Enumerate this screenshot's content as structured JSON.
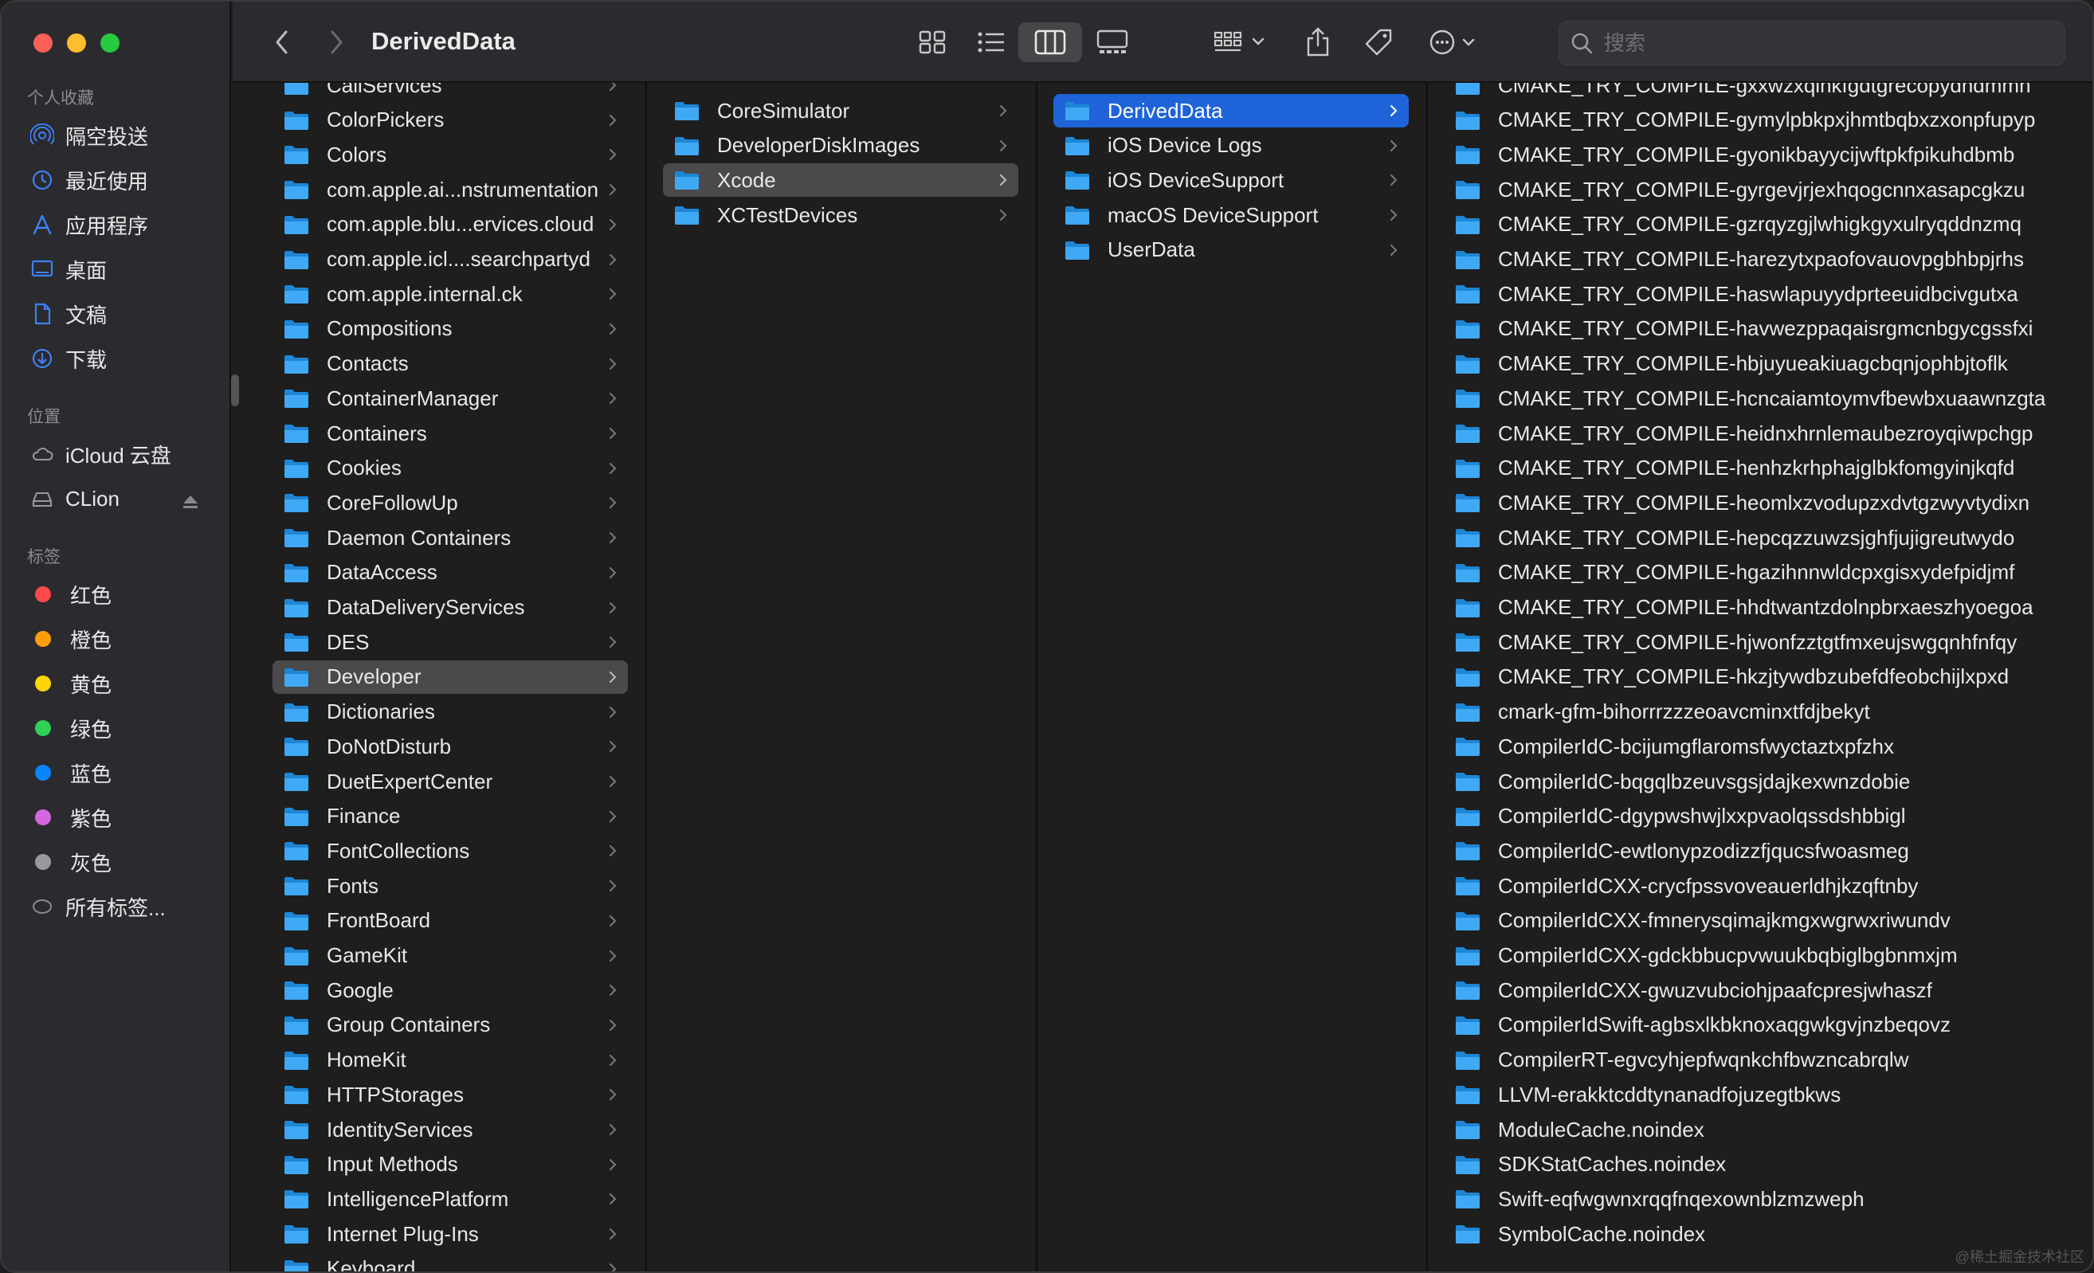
{
  "window": {
    "title": "DerivedData"
  },
  "toolbar": {
    "search_placeholder": "搜索",
    "back": "back",
    "forward": "forward",
    "views": [
      "icon-view",
      "list-view",
      "column-view",
      "gallery-view"
    ],
    "active_view": "column-view"
  },
  "sidebar": {
    "favorites_header": "个人收藏",
    "favorites": [
      {
        "label": "隔空投送",
        "icon": "airdrop-icon"
      },
      {
        "label": "最近使用",
        "icon": "clock-icon"
      },
      {
        "label": "应用程序",
        "icon": "applications-icon"
      },
      {
        "label": "桌面",
        "icon": "desktop-icon"
      },
      {
        "label": "文稿",
        "icon": "document-icon"
      },
      {
        "label": "下载",
        "icon": "download-icon"
      }
    ],
    "locations_header": "位置",
    "locations": [
      {
        "label": "iCloud 云盘",
        "icon": "cloud-icon"
      },
      {
        "label": "CLion",
        "icon": "disk-icon"
      }
    ],
    "tags_header": "标签",
    "tags": [
      {
        "label": "红色",
        "color": "#fe4a4a"
      },
      {
        "label": "橙色",
        "color": "#fe9f0a"
      },
      {
        "label": "黄色",
        "color": "#ffd60a"
      },
      {
        "label": "绿色",
        "color": "#30d158"
      },
      {
        "label": "蓝色",
        "color": "#0a84ff"
      },
      {
        "label": "紫色",
        "color": "#d467e0"
      },
      {
        "label": "灰色",
        "color": "#98989d"
      }
    ],
    "all_tags": "所有标签..."
  },
  "columns": [
    {
      "items": [
        "CallServices",
        "ColorPickers",
        "Colors",
        "com.apple.ai...nstrumentation",
        "com.apple.blu...ervices.cloud",
        "com.apple.icl....searchpartyd",
        "com.apple.internal.ck",
        "Compositions",
        "Contacts",
        "ContainerManager",
        "Containers",
        "Cookies",
        "CoreFollowUp",
        "Daemon Containers",
        "DataAccess",
        "DataDeliveryServices",
        "DES",
        "Developer",
        "Dictionaries",
        "DoNotDisturb",
        "DuetExpertCenter",
        "Finance",
        "FontCollections",
        "Fonts",
        "FrontBoard",
        "GameKit",
        "Google",
        "Group Containers",
        "HomeKit",
        "HTTPStorages",
        "IdentityServices",
        "Input Methods",
        "IntelligencePlatform",
        "Internet Plug-Ins",
        "Keyboard"
      ],
      "selected": "Developer",
      "selected_style": "gray"
    },
    {
      "items": [
        "CoreSimulator",
        "DeveloperDiskImages",
        "Xcode",
        "XCTestDevices"
      ],
      "selected": "Xcode",
      "selected_style": "gray"
    },
    {
      "items": [
        "DerivedData",
        "iOS Device Logs",
        "iOS DeviceSupport",
        "macOS DeviceSupport",
        "UserData"
      ],
      "selected": "DerivedData",
      "selected_style": "blue"
    },
    {
      "items": [
        "CMAKE_TRY_COMPILE-gxxwzxqinkfgdtgrecopydndmmn",
        "CMAKE_TRY_COMPILE-gymylpbkpxjhmtbqbxzxonpfupyp",
        "CMAKE_TRY_COMPILE-gyonikbayycijwftpkfpikuhdbmb",
        "CMAKE_TRY_COMPILE-gyrgevjrjexhqogcnnxasapcgkzu",
        "CMAKE_TRY_COMPILE-gzrqyzgjlwhigkgyxulryqddnzmq",
        "CMAKE_TRY_COMPILE-harezytxpaofovauovpgbhbpjrhs",
        "CMAKE_TRY_COMPILE-haswlapuyydprteeuidbcivgutxa",
        "CMAKE_TRY_COMPILE-havwezppaqaisrgmcnbgycgssfxi",
        "CMAKE_TRY_COMPILE-hbjuyueakiuagcbqnjophbjtoflk",
        "CMAKE_TRY_COMPILE-hcncaiamtoymvfbewbxuaawnzgta",
        "CMAKE_TRY_COMPILE-heidnxhrnlemaubezroyqiwpchgp",
        "CMAKE_TRY_COMPILE-henhzkrhphajglbkfomgyinjkqfd",
        "CMAKE_TRY_COMPILE-heomlxzvodupzxdvtgzwyvtydixn",
        "CMAKE_TRY_COMPILE-hepcqzzuwzsjghfjujigreutwydo",
        "CMAKE_TRY_COMPILE-hgazihnnwldcpxgisxydefpidjmf",
        "CMAKE_TRY_COMPILE-hhdtwantzdolnpbrxaeszhyoegoa",
        "CMAKE_TRY_COMPILE-hjwonfzztgtfmxeujswgqnhfnfqy",
        "CMAKE_TRY_COMPILE-hkzjtywdbzubefdfeobchijlxpxd",
        "cmark-gfm-bihorrrzzzeoavcminxtfdjbekyt",
        "CompilerIdC-bcijumgflaromsfwyctaztxpfzhx",
        "CompilerIdC-bqgqlbzeuvsgsjdajkexwnzdobie",
        "CompilerIdC-dgypwshwjlxxpvaolqssdshbbigl",
        "CompilerIdC-ewtlonypzodizzfjqucsfwoasmeg",
        "CompilerIdCXX-crycfpssvoveauerldhjkzqftnby",
        "CompilerIdCXX-fmnerysqimajkmgxwgrwxriwundv",
        "CompilerIdCXX-gdckbbucpvwuukbqbiglbgbnmxjm",
        "CompilerIdCXX-gwuzvubciohjpaafcpresjwhaszf",
        "CompilerIdSwift-agbsxlkbknoxaqgwkgvjnzbeqovz",
        "CompilerRT-egvcyhjepfwqnkchfbwzncabrqlw",
        "LLVM-erakktcddtynanadfojuzegtbkws",
        "ModuleCache.noindex",
        "SDKStatCaches.noindex",
        "Swift-eqfwgwnxrqqfnqexownblzmzweph",
        "SymbolCache.noindex"
      ],
      "selected": null,
      "selected_style": null
    }
  ],
  "watermark": "@稀土掘金技术社区",
  "colors": {
    "accent": "#1f63d8",
    "folder": "#3fa9f5",
    "folder_dark": "#1f86d6"
  }
}
